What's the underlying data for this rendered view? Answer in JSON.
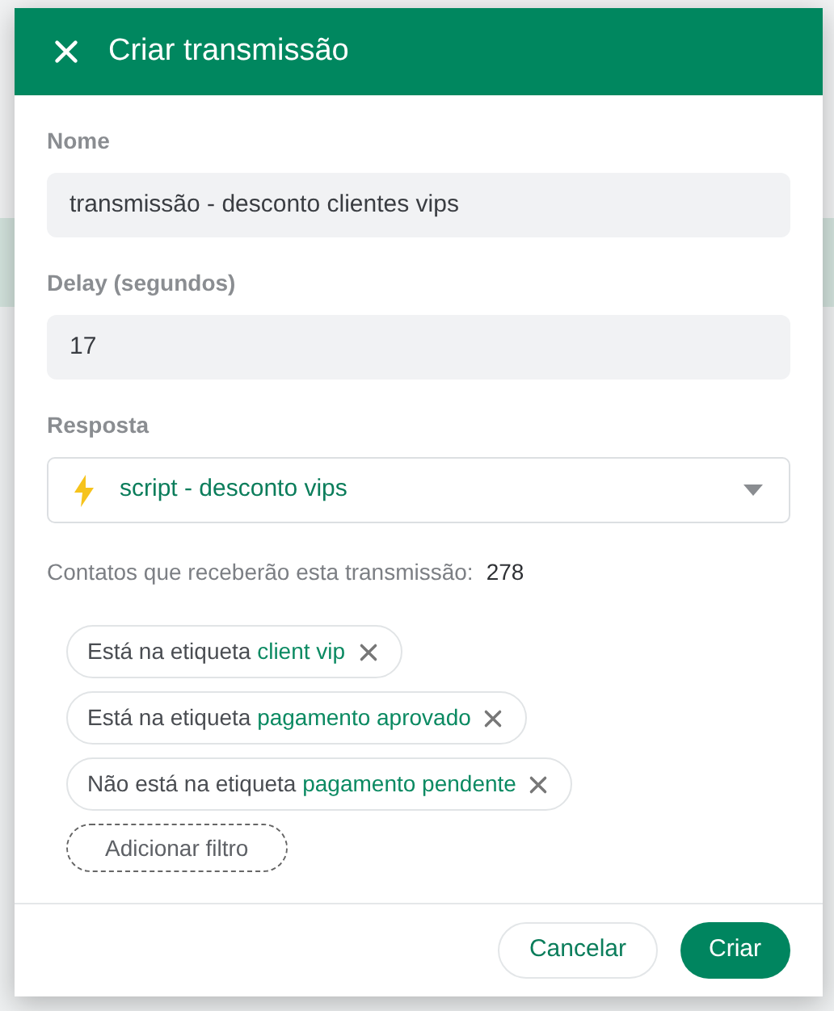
{
  "dialog": {
    "title": "Criar transmissão"
  },
  "fields": [
    {
      "label": "Nome",
      "value": "transmissão - desconto clientes vips"
    },
    {
      "label": "Delay (segundos)",
      "value": "17"
    }
  ],
  "response": {
    "label": "Resposta",
    "value": "script - desconto vips"
  },
  "contacts": {
    "label": "Contatos que receberão esta transmissão:",
    "count": "278"
  },
  "filters": [
    {
      "prefix": "Está na etiqueta",
      "tag": "client vip"
    },
    {
      "prefix": "Está na etiqueta",
      "tag": "pagamento aprovado"
    },
    {
      "prefix": "Não está na etiqueta",
      "tag": "pagamento pendente"
    }
  ],
  "add_filter": "Adicionar filtro",
  "buttons": [
    {
      "label": "Cancelar",
      "kind": "secondary"
    },
    {
      "label": "Criar",
      "kind": "primary"
    }
  ]
}
